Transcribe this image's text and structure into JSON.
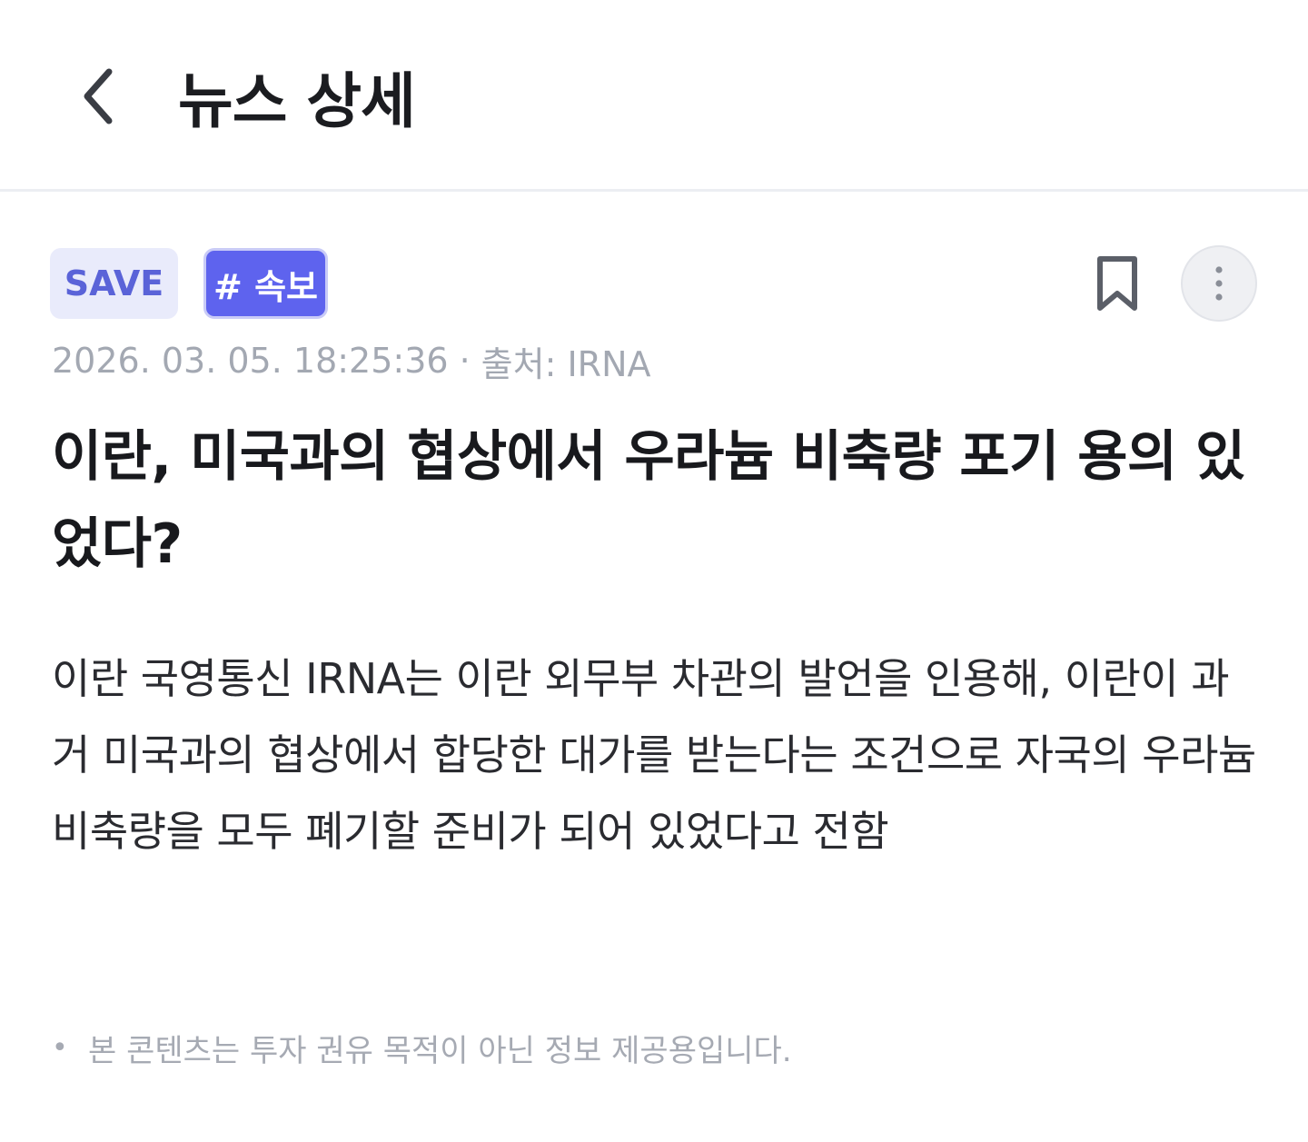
{
  "header": {
    "title": "뉴스 상세"
  },
  "article": {
    "tags": {
      "save": "SAVE",
      "breaking": "# 속보"
    },
    "meta": {
      "datetime": "2026. 03. 05. 18:25:36",
      "separator": "·",
      "source": "출처: IRNA"
    },
    "headline": "이란, 미국과의 협상에서 우라늄 비축량 포기 용의 있었다?",
    "body": "이란 국영통신 IRNA는 이란 외무부 차관의 발언을 인용해, 이란이 과거 미국과의 협상에서 합당한 대가를 받는다는 조건으로 자국의 우라늄 비축량을 모두 폐기할 준비가 되어 있었다고 전함",
    "disclaimer": "본 콘텐츠는 투자 권유 목적이 아닌 정보 제공용입니다."
  },
  "icons": {
    "back": "chevron-left-icon",
    "bookmark": "bookmark-icon",
    "more": "more-vertical-icon"
  },
  "colors": {
    "accent": "#5e63ee",
    "save_tag_bg": "#e9ebfb",
    "save_tag_text": "#5a63d8",
    "meta_text": "#a3a8b2"
  }
}
